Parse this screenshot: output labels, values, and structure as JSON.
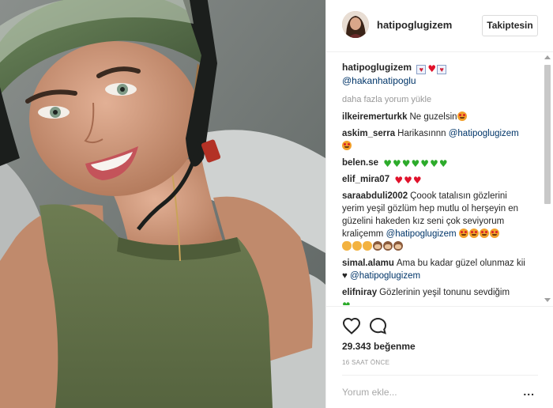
{
  "post": {
    "photo_icon": "selfie-photo",
    "username": "hatipoglugizem",
    "follow_label": "Takiptesin",
    "caption": {
      "username": "hatipoglugizem",
      "mention": "@hakanhatipoglu"
    },
    "load_more": "daha fazla yorum yükle",
    "comments": [
      {
        "user": "ilkeiremerturkk",
        "text": "Ne guzelsin"
      },
      {
        "user": "askim_serra",
        "text": "Harikasınnn",
        "mention": "@hatipoglugizem"
      },
      {
        "user": "belen.se",
        "text": ""
      },
      {
        "user": "elif_mira07",
        "text": ""
      },
      {
        "user": "saraabduli2002",
        "text": "Çoook tatalısın gözlerini yerim yeşil gözlüm hep mutlu ol herşeyin en güzelini hakeden kız seni çok seviyorum kraliçemm",
        "mention": "@hatipoglugizem"
      },
      {
        "user": "simal.alamu",
        "text": "Ama bu kadar güzel olunmaz kii ♥",
        "mention": "@hatipoglugizem"
      },
      {
        "user": "elifniray",
        "text": "Gözlerinin yeşil tonunu sevdiğim"
      }
    ],
    "likes": "29.343 beğenme",
    "time": "16 SAAT ÖNCE",
    "comment_placeholder": "Yorum ekle...",
    "more_options": "...",
    "colors": {
      "mention": "#003569",
      "heart_red": "#e0122b",
      "heart_green": "#2dab2b"
    },
    "icons": [
      "heart-outline-icon",
      "speech-bubble-icon",
      "scroll-up-icon",
      "scroll-down-icon"
    ]
  }
}
